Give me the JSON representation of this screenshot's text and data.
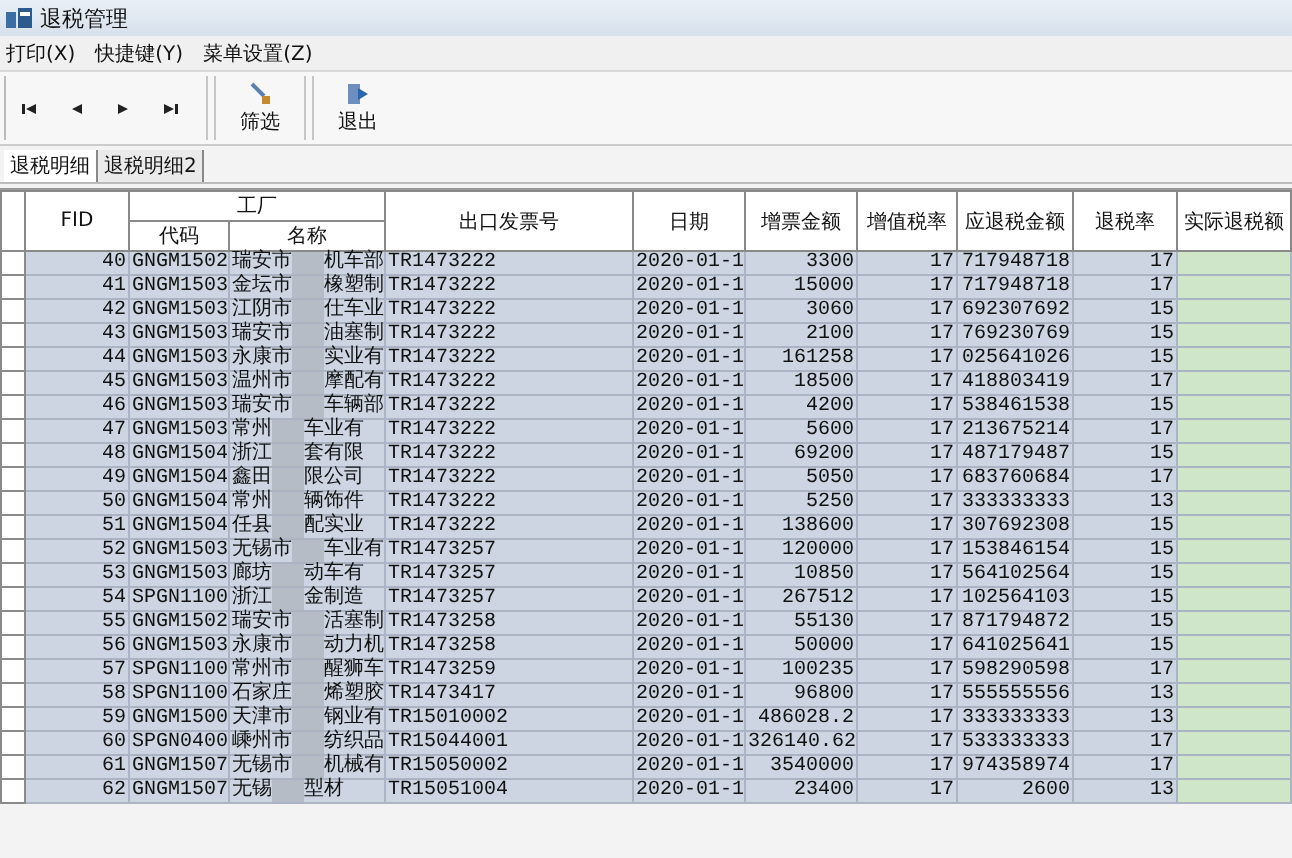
{
  "window": {
    "title": "退税管理"
  },
  "menu": [
    "打印(X)",
    "快捷键(Y)",
    "菜单设置(Z)"
  ],
  "toolbar": [
    {
      "kind": "first"
    },
    {
      "kind": "prev"
    },
    {
      "kind": "next"
    },
    {
      "kind": "last"
    },
    {
      "kind": "filter",
      "label": "筛选"
    },
    {
      "kind": "exit",
      "label": "退出"
    }
  ],
  "tabs": [
    {
      "label": "退税明细",
      "selected": true
    },
    {
      "label": "退税明细2",
      "selected": false
    }
  ],
  "table": {
    "group_header": "工厂",
    "columns": [
      "FID",
      "代码",
      "名称",
      "出口发票号",
      "日期",
      "增票金额",
      "增值税率",
      "应退税金额",
      "退税率",
      "实际退税额"
    ],
    "rows": [
      {
        "fid": "40",
        "code": "GNGM1502",
        "name_start": "瑞安市",
        "name_end": "机车部",
        "invoice": "TR1473222",
        "date": "2020-01-1",
        "amount": "3300",
        "vat_rate": "17",
        "refund_amount": "717948718",
        "refund_rate": "17"
      },
      {
        "fid": "41",
        "code": "GNGM1503",
        "name_start": "金坛市",
        "name_end": "橡塑制",
        "invoice": "TR1473222",
        "date": "2020-01-1",
        "amount": "15000",
        "vat_rate": "17",
        "refund_amount": "717948718",
        "refund_rate": "17"
      },
      {
        "fid": "42",
        "code": "GNGM1503",
        "name_start": "江阴市",
        "name_end": "仕车业",
        "invoice": "TR1473222",
        "date": "2020-01-1",
        "amount": "3060",
        "vat_rate": "17",
        "refund_amount": "692307692",
        "refund_rate": "15"
      },
      {
        "fid": "43",
        "code": "GNGM1503",
        "name_start": "瑞安市",
        "name_end": "油塞制",
        "invoice": "TR1473222",
        "date": "2020-01-1",
        "amount": "2100",
        "vat_rate": "17",
        "refund_amount": "769230769",
        "refund_rate": "15"
      },
      {
        "fid": "44",
        "code": "GNGM1503",
        "name_start": "永康市",
        "name_end": "实业有",
        "invoice": "TR1473222",
        "date": "2020-01-1",
        "amount": "161258",
        "vat_rate": "17",
        "refund_amount": "025641026",
        "refund_rate": "15"
      },
      {
        "fid": "45",
        "code": "GNGM1503",
        "name_start": "温州市",
        "name_end": "摩配有",
        "invoice": "TR1473222",
        "date": "2020-01-1",
        "amount": "18500",
        "vat_rate": "17",
        "refund_amount": "418803419",
        "refund_rate": "17"
      },
      {
        "fid": "46",
        "code": "GNGM1503",
        "name_start": "瑞安市",
        "name_end": "车辆部",
        "invoice": "TR1473222",
        "date": "2020-01-1",
        "amount": "4200",
        "vat_rate": "17",
        "refund_amount": "538461538",
        "refund_rate": "15"
      },
      {
        "fid": "47",
        "code": "GNGM1503",
        "name_start": "常州",
        "name_end": "车业有",
        "invoice": "TR1473222",
        "date": "2020-01-1",
        "amount": "5600",
        "vat_rate": "17",
        "refund_amount": "213675214",
        "refund_rate": "17"
      },
      {
        "fid": "48",
        "code": "GNGM1504",
        "name_start": "浙江",
        "name_end": "套有限",
        "invoice": "TR1473222",
        "date": "2020-01-1",
        "amount": "69200",
        "vat_rate": "17",
        "refund_amount": "487179487",
        "refund_rate": "15"
      },
      {
        "fid": "49",
        "code": "GNGM1504",
        "name_start": "鑫田",
        "name_end": "限公司",
        "invoice": "TR1473222",
        "date": "2020-01-1",
        "amount": "5050",
        "vat_rate": "17",
        "refund_amount": "683760684",
        "refund_rate": "17"
      },
      {
        "fid": "50",
        "code": "GNGM1504",
        "name_start": "常州",
        "name_end": "辆饰件",
        "invoice": "TR1473222",
        "date": "2020-01-1",
        "amount": "5250",
        "vat_rate": "17",
        "refund_amount": "333333333",
        "refund_rate": "13"
      },
      {
        "fid": "51",
        "code": "GNGM1504",
        "name_start": "任县",
        "name_end": "配实业",
        "invoice": "TR1473222",
        "date": "2020-01-1",
        "amount": "138600",
        "vat_rate": "17",
        "refund_amount": "307692308",
        "refund_rate": "15"
      },
      {
        "fid": "52",
        "code": "GNGM1503",
        "name_start": "无锡市",
        "name_end": "车业有",
        "invoice": "TR1473257",
        "date": "2020-01-1",
        "amount": "120000",
        "vat_rate": "17",
        "refund_amount": "153846154",
        "refund_rate": "15"
      },
      {
        "fid": "53",
        "code": "GNGM1503",
        "name_start": "廊坊",
        "name_end": "动车有",
        "invoice": "TR1473257",
        "date": "2020-01-1",
        "amount": "10850",
        "vat_rate": "17",
        "refund_amount": "564102564",
        "refund_rate": "15"
      },
      {
        "fid": "54",
        "code": "SPGN1100",
        "name_start": "浙江",
        "name_end": "金制造",
        "invoice": "TR1473257",
        "date": "2020-01-1",
        "amount": "267512",
        "vat_rate": "17",
        "refund_amount": "102564103",
        "refund_rate": "15"
      },
      {
        "fid": "55",
        "code": "GNGM1502",
        "name_start": "瑞安市",
        "name_end": "活塞制",
        "invoice": "TR1473258",
        "date": "2020-01-1",
        "amount": "55130",
        "vat_rate": "17",
        "refund_amount": "871794872",
        "refund_rate": "15"
      },
      {
        "fid": "56",
        "code": "GNGM1503",
        "name_start": "永康市",
        "name_end": "动力机",
        "invoice": "TR1473258",
        "date": "2020-01-1",
        "amount": "50000",
        "vat_rate": "17",
        "refund_amount": "641025641",
        "refund_rate": "15"
      },
      {
        "fid": "57",
        "code": "SPGN1100",
        "name_start": "常州市",
        "name_end": "醒狮车",
        "invoice": "TR1473259",
        "date": "2020-01-1",
        "amount": "100235",
        "vat_rate": "17",
        "refund_amount": "598290598",
        "refund_rate": "17"
      },
      {
        "fid": "58",
        "code": "SPGN1100",
        "name_start": "石家庄",
        "name_end": "烯塑胶",
        "invoice": "TR1473417",
        "date": "2020-01-1",
        "amount": "96800",
        "vat_rate": "17",
        "refund_amount": "555555556",
        "refund_rate": "13"
      },
      {
        "fid": "59",
        "code": "GNGM1500",
        "name_start": "天津市",
        "name_end": "钢业有",
        "invoice": "TR15010002",
        "date": "2020-01-1",
        "amount": "486028.2",
        "vat_rate": "17",
        "refund_amount": "333333333",
        "refund_rate": "13"
      },
      {
        "fid": "60",
        "code": "SPGN0400",
        "name_start": "嵊州市",
        "name_end": "纺织品",
        "invoice": "TR15044001",
        "date": "2020-01-1",
        "amount": "326140.62",
        "vat_rate": "17",
        "refund_amount": "533333333",
        "refund_rate": "17"
      },
      {
        "fid": "61",
        "code": "GNGM1507",
        "name_start": "无锡市",
        "name_end": "机械有",
        "invoice": "TR15050002",
        "date": "2020-01-1",
        "amount": "3540000",
        "vat_rate": "17",
        "refund_amount": "974358974",
        "refund_rate": "17"
      },
      {
        "fid": "62",
        "code": "GNGM1507",
        "name_start": "无锡",
        "name_end": "型材",
        "invoice": "TR15051004",
        "date": "2020-01-1",
        "amount": "23400",
        "vat_rate": "17",
        "refund_amount": "2600",
        "refund_rate": "13"
      }
    ]
  }
}
